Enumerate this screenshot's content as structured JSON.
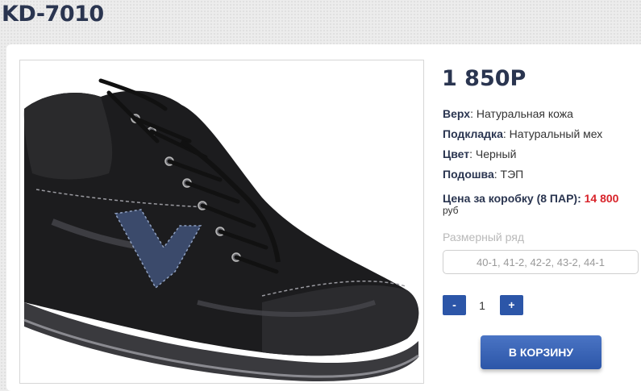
{
  "product": {
    "title": "KD-7010",
    "price": "1 850Р",
    "image_alt": "Черный кожаный ботинок KD-7010"
  },
  "specs": [
    {
      "key": "Верх",
      "sep": ": ",
      "value": "Натуральная кожа"
    },
    {
      "key": "Подкладка",
      "sep": ": ",
      "value": "Натуральный мех"
    },
    {
      "key": "Цвет",
      "sep": ": ",
      "value": "Черный"
    },
    {
      "key": "Подошва",
      "sep": ": ",
      "value": "ТЭП"
    }
  ],
  "box_price": {
    "label": "Цена за коробку (8 ПАР):",
    "value": "14 800",
    "unit": "руб"
  },
  "sizes": {
    "label": "Размерный ряд",
    "value": "40-1, 41-2, 42-2, 43-2, 44-1"
  },
  "quantity": {
    "minus": "-",
    "value": "1",
    "plus": "+"
  },
  "cart_button": "В КОРЗИНУ",
  "colors": {
    "accent": "#2c56a8",
    "title": "#2a3550",
    "price_highlight": "#d8232a"
  }
}
